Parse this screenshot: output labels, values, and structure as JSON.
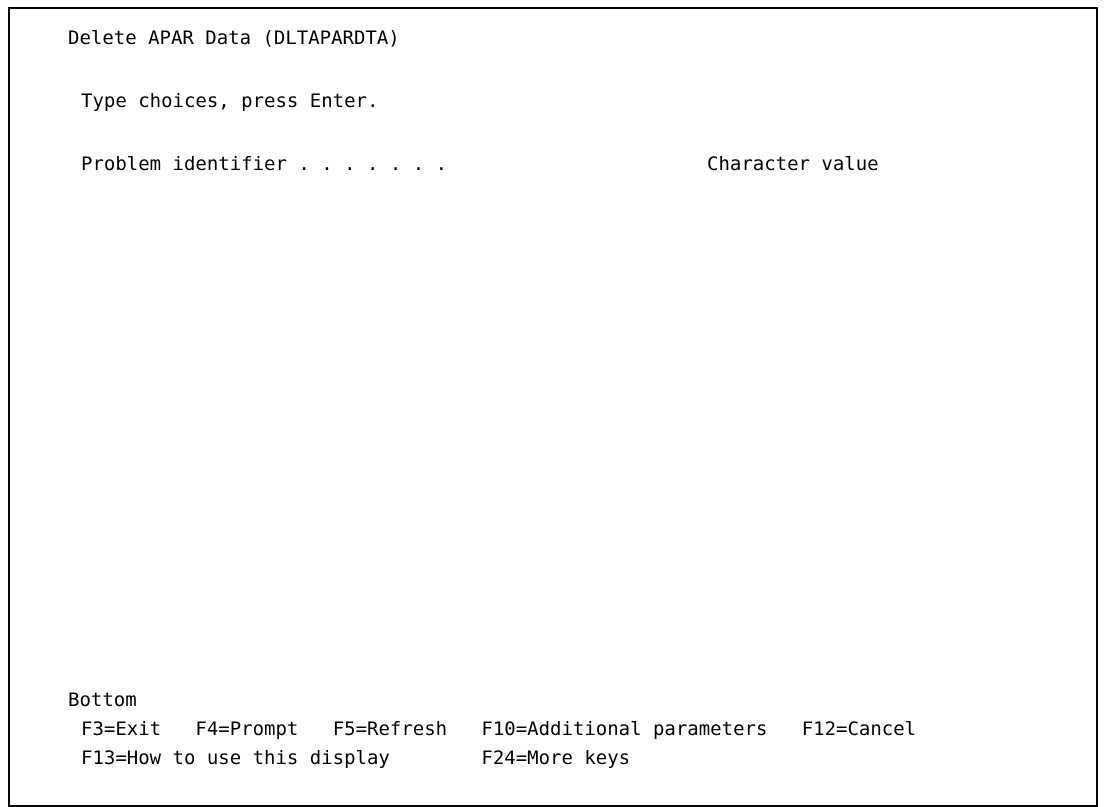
{
  "screen": {
    "title": "Delete APAR Data (DLTAPARDTA)",
    "instructions": "Type choices, press Enter.",
    "field": {
      "label": "Problem identifier . . . . . . .",
      "value": "",
      "hint": "Character value"
    },
    "position_indicator": "Bottom",
    "function_keys_row1": [
      "F3=Exit",
      "F4=Prompt",
      "F5=Refresh",
      "F10=Additional parameters",
      "F12=Cancel"
    ],
    "function_keys_row2": [
      "F13=How to use this display",
      "F24=More keys"
    ]
  }
}
